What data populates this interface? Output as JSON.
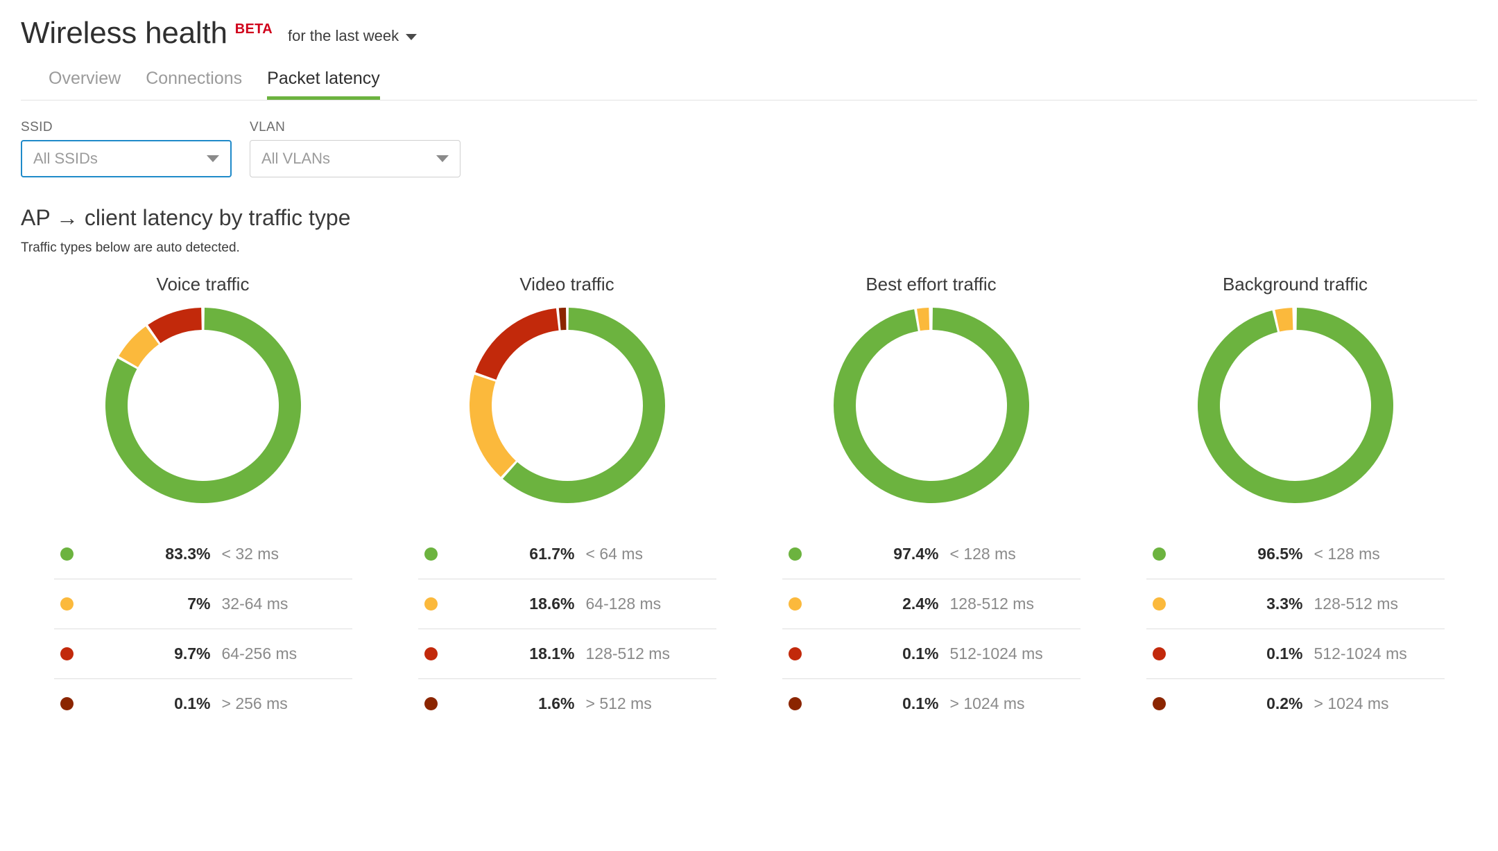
{
  "header": {
    "title": "Wireless health",
    "beta_badge": "BETA",
    "timeframe_label": "for the last week",
    "caret_icon": "chevron-down-icon"
  },
  "tabs": [
    {
      "label": "Overview",
      "active": false
    },
    {
      "label": "Connections",
      "active": false
    },
    {
      "label": "Packet latency",
      "active": true
    }
  ],
  "filters": [
    {
      "label": "SSID",
      "value": "All SSIDs",
      "focused": true
    },
    {
      "label": "VLAN",
      "value": "All VLANs",
      "focused": false
    }
  ],
  "section": {
    "title": "AP → client latency by traffic type",
    "subtitle": "Traffic types below are auto detected."
  },
  "colors": {
    "green": "#6cb33f",
    "yellow": "#fbb93c",
    "red": "#c2290b",
    "dark_red": "#8b2500",
    "tab_active_underline": "#6cb33f",
    "beta": "#d0021b",
    "focus_border": "#1f8ac9"
  },
  "chart_data": [
    {
      "type": "pie",
      "title": "Voice traffic",
      "categories": [
        "< 32 ms",
        "32-64 ms",
        "64-256 ms",
        "> 256 ms"
      ],
      "values": [
        83.3,
        7,
        9.7,
        0.1
      ],
      "labels": [
        "83.3%",
        "7%",
        "9.7%",
        "0.1%"
      ],
      "colors": [
        "#6cb33f",
        "#fbb93c",
        "#c2290b",
        "#8b2500"
      ]
    },
    {
      "type": "pie",
      "title": "Video traffic",
      "categories": [
        "< 64 ms",
        "64-128 ms",
        "128-512 ms",
        "> 512 ms"
      ],
      "values": [
        61.7,
        18.6,
        18.1,
        1.6
      ],
      "labels": [
        "61.7%",
        "18.6%",
        "18.1%",
        "1.6%"
      ],
      "colors": [
        "#6cb33f",
        "#fbb93c",
        "#c2290b",
        "#8b2500"
      ]
    },
    {
      "type": "pie",
      "title": "Best effort traffic",
      "categories": [
        "< 128 ms",
        "128-512 ms",
        "512-1024 ms",
        "> 1024 ms"
      ],
      "values": [
        97.4,
        2.4,
        0.1,
        0.1
      ],
      "labels": [
        "97.4%",
        "2.4%",
        "0.1%",
        "0.1%"
      ],
      "colors": [
        "#6cb33f",
        "#fbb93c",
        "#c2290b",
        "#8b2500"
      ]
    },
    {
      "type": "pie",
      "title": "Background traffic",
      "categories": [
        "< 128 ms",
        "128-512 ms",
        "512-1024 ms",
        "> 1024 ms"
      ],
      "values": [
        96.5,
        3.3,
        0.1,
        0.2
      ],
      "labels": [
        "96.5%",
        "3.3%",
        "0.1%",
        "0.2%"
      ],
      "colors": [
        "#6cb33f",
        "#fbb93c",
        "#c2290b",
        "#8b2500"
      ]
    }
  ]
}
